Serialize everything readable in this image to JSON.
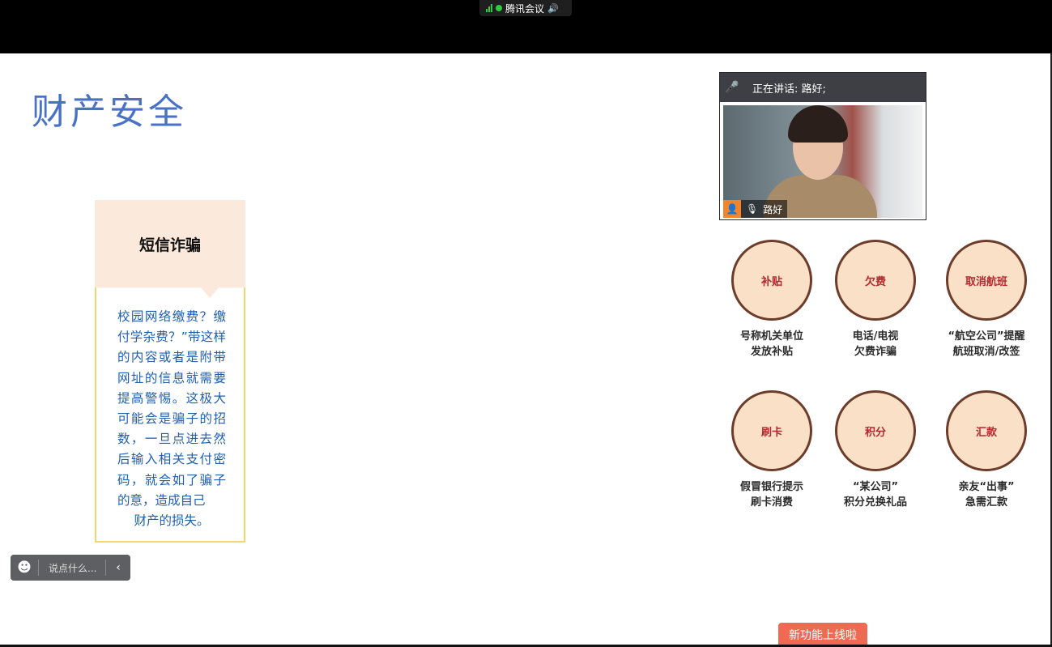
{
  "meeting": {
    "app_name": "腾讯会议",
    "speaker_icon": "speaker-icon",
    "signal_icon": "signal-icon"
  },
  "slide": {
    "title": "财产安全",
    "card": {
      "heading": "短信诈骗",
      "body": "校园网络缴费？缴付学杂费？”带这样的内容或者是附带网址的信息就需要提高警惕。这极大可能会是骗子的招数，一旦点进去然后输入相关支付密码，就会如了骗子的意，造成自己",
      "body_last": "财产的损失。"
    },
    "scams": [
      {
        "icon_text": "补贴",
        "label1": "号称机关单位",
        "label2": "发放补贴"
      },
      {
        "icon_text": "欠费",
        "label1": "电话/电视",
        "label2": "欠费诈骗"
      },
      {
        "icon_text": "取消航班",
        "label1": "“航空公司”提醒",
        "label2": "航班取消/改签"
      },
      {
        "icon_text": "刷卡",
        "label1": "假冒银行提示",
        "label2": "刷卡消费"
      },
      {
        "icon_text": "积分",
        "label1": "“某公司”",
        "label2": "积分兑换礼品"
      },
      {
        "icon_text": "汇款",
        "label1": "亲友“出事”",
        "label2": "急需汇款"
      }
    ]
  },
  "video": {
    "talking_label": "正在讲话: 路好;",
    "participant_name": "路好"
  },
  "chat": {
    "placeholder": "说点什么..."
  },
  "new_feature": {
    "label": "新功能上线啦"
  },
  "colors": {
    "title": "#4a72c4",
    "card_text": "#1f5fae",
    "accent": "#ef6a52"
  }
}
